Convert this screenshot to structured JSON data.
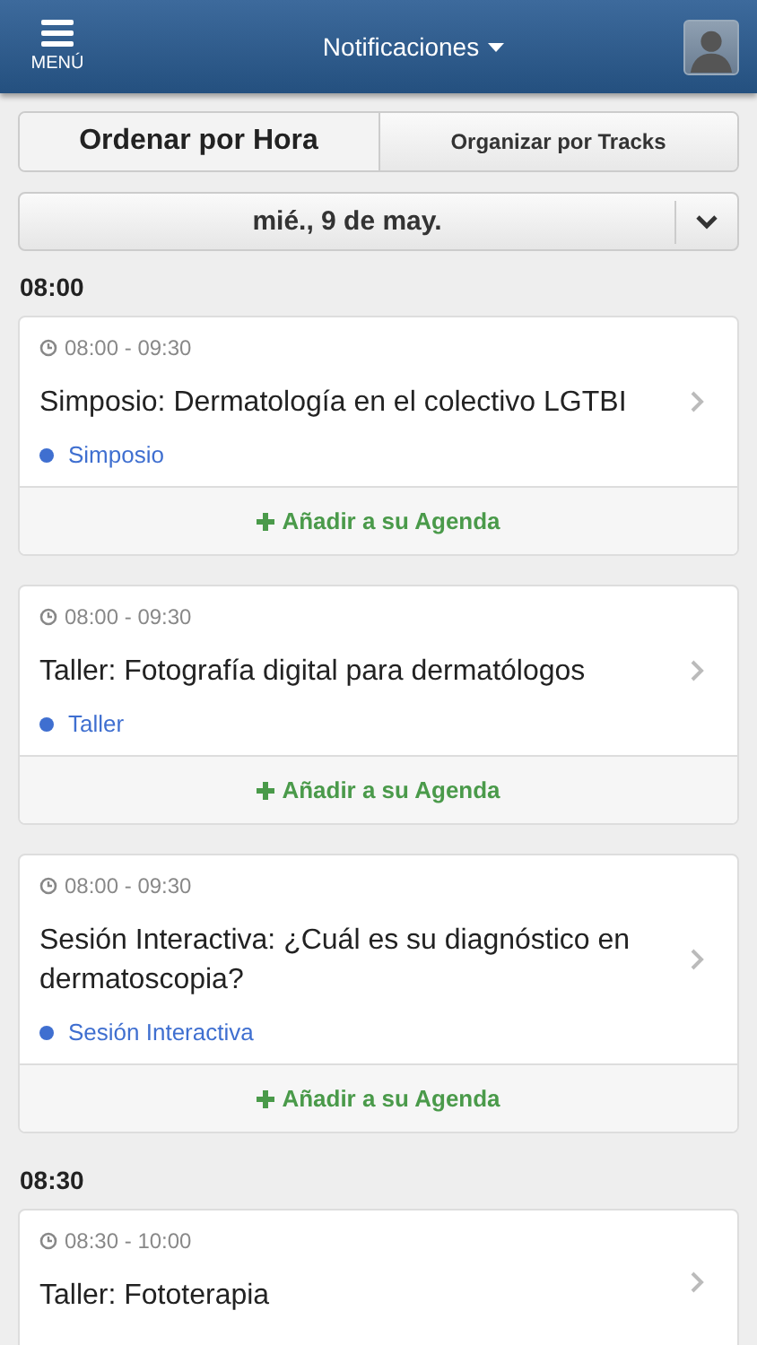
{
  "header": {
    "menu_label": "MENÚ",
    "title": "Notificaciones"
  },
  "tabs": [
    {
      "label": "Ordenar por Hora",
      "selected": true
    },
    {
      "label": "Organizar por Tracks",
      "selected": false
    }
  ],
  "date_select": {
    "value": "mié., 9 de may."
  },
  "groups": [
    {
      "time": "08:00",
      "sessions": [
        {
          "time": "08:00 - 09:30",
          "title": "Simposio: Dermatología en el colectivo LGTBI",
          "track": "Simposio",
          "color": "#3f6fd0",
          "action": "Añadir a su Agenda"
        },
        {
          "time": "08:00 - 09:30",
          "title": "Taller: Fotografía digital para dermatólogos",
          "track": "Taller",
          "color": "#3f6fd0",
          "action": "Añadir a su Agenda"
        },
        {
          "time": "08:00 - 09:30",
          "title": "Sesión Interactiva: ¿Cuál es su diagnóstico en dermatoscopia?",
          "track": "Sesión Interactiva",
          "color": "#3f6fd0",
          "action": "Añadir a su Agenda"
        }
      ]
    },
    {
      "time": "08:30",
      "sessions": [
        {
          "time": "08:30 - 10:00",
          "title": "Taller: Fototerapia"
        }
      ]
    }
  ]
}
